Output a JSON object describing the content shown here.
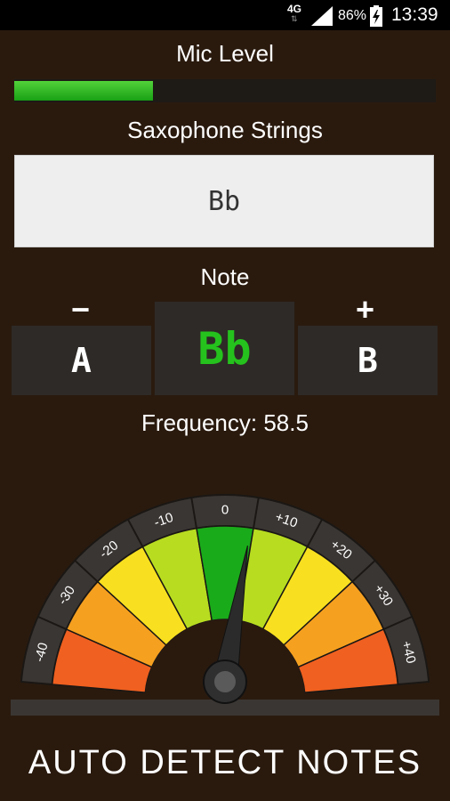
{
  "status_bar": {
    "network": "4G",
    "battery_percent": "86%",
    "time": "13:39",
    "icons": [
      "network-arrows-icon",
      "signal-icon",
      "battery-charging-icon"
    ]
  },
  "mic": {
    "label": "Mic Level",
    "level_fraction": 0.33,
    "fill_color": "#2bb321"
  },
  "instrument": {
    "label": "Saxophone Strings",
    "selected_string": "Bb"
  },
  "note": {
    "label": "Note",
    "minus_sign": "−",
    "plus_sign": "+",
    "previous": "A",
    "current": "Bb",
    "next": "B",
    "current_color": "#25c21d"
  },
  "frequency": {
    "text": "Frequency: 58.5"
  },
  "gauge": {
    "ticks": [
      "-40",
      "-30",
      "-20",
      "-10",
      "0",
      "+10",
      "+20",
      "+30",
      "+40"
    ],
    "needle_cents": 5,
    "segment_colors": [
      "#f06020",
      "#f6a020",
      "#f8e020",
      "#b8dc20",
      "#1aab1a",
      "#b8dc20",
      "#f8e020",
      "#f6a020",
      "#f06020"
    ]
  },
  "footer": {
    "button_label": "AUTO DETECT NOTES"
  }
}
